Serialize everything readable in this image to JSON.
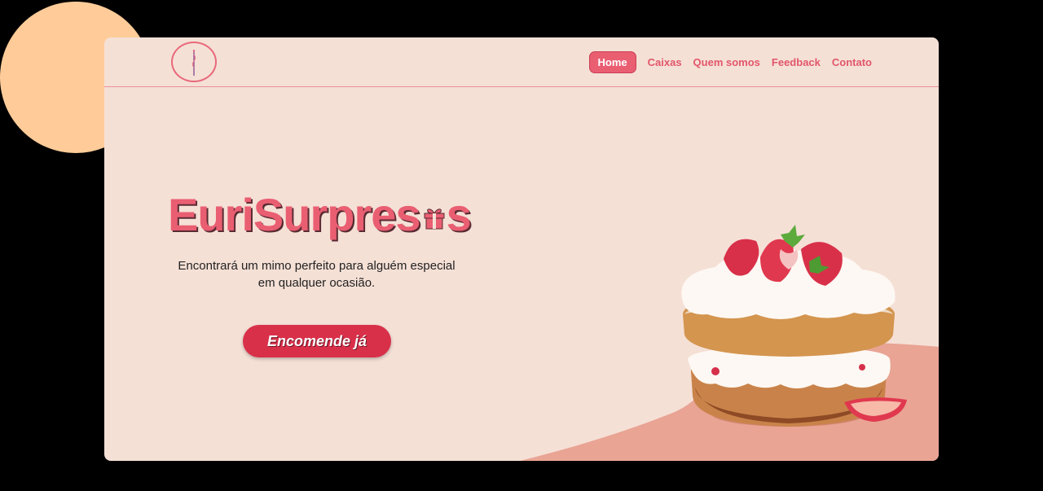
{
  "brand": {
    "title_prefix": "EuriSurpres",
    "title_suffix": "s",
    "gift_icon": "gift-icon"
  },
  "nav": {
    "items": [
      {
        "label": "Home",
        "active": true
      },
      {
        "label": "Caixas",
        "active": false
      },
      {
        "label": "Quem somos",
        "active": false
      },
      {
        "label": "Feedback",
        "active": false
      },
      {
        "label": "Contato",
        "active": false
      }
    ]
  },
  "hero": {
    "subtitle_line1": "Encontrará um mimo perfeito para alguém especial",
    "subtitle_line2": "em qualquer ocasião.",
    "cta_label": "Encomende já"
  },
  "colors": {
    "page_background": "#000000",
    "card_background": "#f5e0d6",
    "accent": "#ea5e72",
    "cta": "#d9304a",
    "circle": "#ffcc99",
    "blob": "#e9a494"
  }
}
